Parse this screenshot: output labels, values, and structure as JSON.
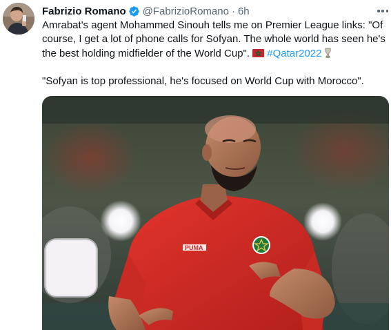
{
  "author": {
    "name": "Fabrizio Romano",
    "handle": "@FabrizioRomano",
    "separator": "·",
    "time": "6h",
    "verified": true
  },
  "tweet": {
    "line1": "Amrabat's agent Mohammed Sinouh tells me on Premier League links: \"Of course, I get a lot of phone calls for Sofyan. The whole world has seen he's the best holding midfielder of the World Cup\".",
    "hashtag": "#Qatar2022",
    "line2": "\"Sofyan is top professional, he's focused on World Cup with Morocco\"."
  },
  "media": {
    "jersey_brand": "PUMA"
  },
  "icons": {
    "verified": "verified-badge-icon",
    "more": "more-options-icon",
    "flag": "morocco-flag-emoji",
    "trophy": "trophy-emoji"
  },
  "colors": {
    "accent": "#1d9bf0",
    "secondary_text": "#536471",
    "jersey": "#d62a25"
  }
}
